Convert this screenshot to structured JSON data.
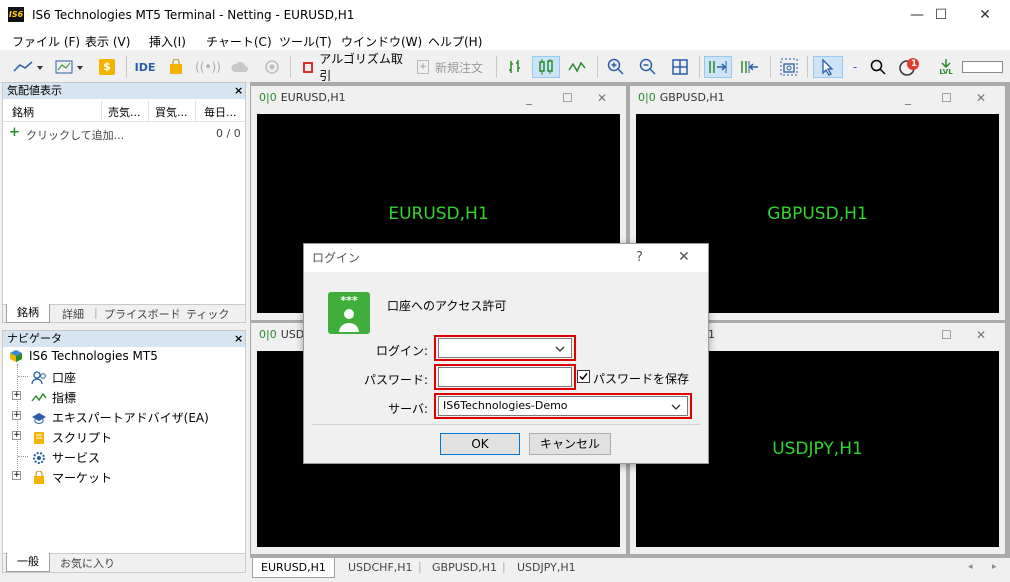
{
  "window": {
    "title": "IS6 Technologies MT5 Terminal - Netting - EURUSD,H1",
    "logo_text": "IS6",
    "minimize": "—",
    "maximize": "☐",
    "close": "✕"
  },
  "menu": [
    "ファイル (F)",
    "表示 (V)",
    "挿入(I)",
    "チャート(C)",
    "ツール(T)",
    "ウインドウ(W)",
    "ヘルプ(H)"
  ],
  "toolbar": {
    "ide": "IDE",
    "algo": "アルゴリズム取引",
    "new_order": "新規注文",
    "lvl": "LVL",
    "notifications": "1"
  },
  "market_watch": {
    "title": "気配値表示",
    "close": "×",
    "columns": [
      "銘柄",
      "売気...",
      "買気...",
      "毎日..."
    ],
    "add_row": "クリックして追加...",
    "count": "0 / 0",
    "tabs": [
      "銘柄",
      "詳細",
      "プライスボード",
      "ティック"
    ]
  },
  "navigator": {
    "title": "ナビゲータ",
    "close": "×",
    "root": "IS6 Technologies MT5",
    "items": [
      "口座",
      "指標",
      "エキスパートアドバイザ(EA)",
      "スクリプト",
      "サービス",
      "マーケット"
    ],
    "tabs": [
      "一般",
      "お気に入り"
    ]
  },
  "charts": [
    {
      "caption": "EURUSD,H1",
      "label": "EURUSD,H1"
    },
    {
      "caption": "GBPUSD,H1",
      "label": "GBPUSD,H1"
    },
    {
      "caption": "USDC",
      "label": ""
    },
    {
      "caption": "1",
      "label": "USDJPY,H1"
    }
  ],
  "bottom_tabs": [
    "EURUSD,H1",
    "USDCHF,H1",
    "GBPUSD,H1",
    "USDJPY,H1"
  ],
  "login_dialog": {
    "title": "ログイン",
    "help": "?",
    "close": "✕",
    "heading": "口座へのアクセス許可",
    "icon_text": "***",
    "login_label": "ログイン:",
    "login_value": "",
    "password_label": "パスワード:",
    "password_value": "",
    "save_password": "パスワードを保存",
    "save_password_checked": true,
    "server_label": "サーバ:",
    "server_value": "IS6Technologies-Demo",
    "ok": "OK",
    "cancel": "キャンセル"
  }
}
